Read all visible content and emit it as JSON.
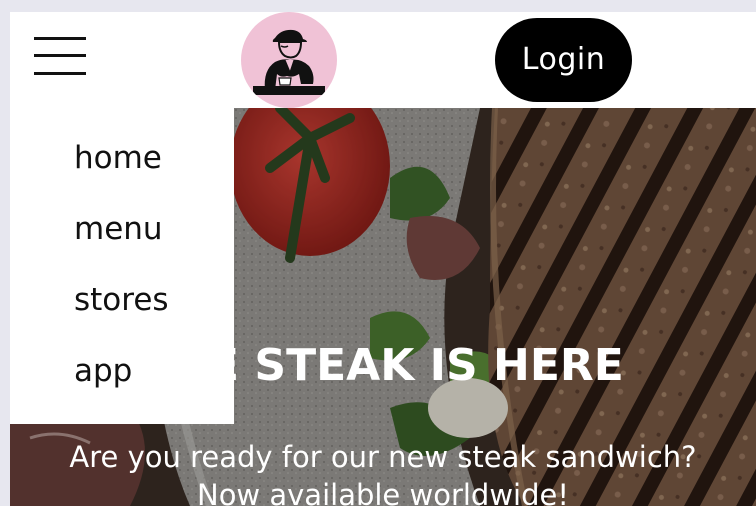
{
  "header": {
    "menu_icon": "hamburger-menu-icon",
    "logo_icon": "man-drinking-coffee-logo",
    "login_label": "Login"
  },
  "nav": {
    "items": [
      {
        "label": "home"
      },
      {
        "label": "menu"
      },
      {
        "label": "stores"
      },
      {
        "label": "app"
      }
    ]
  },
  "hero": {
    "title": "THE STEAK IS HERE",
    "subtitle_line1": "Are you ready for our new steak sandwich?",
    "subtitle_line2": "Now available worldwide!"
  },
  "colors": {
    "logo_bg": "#f0c2d6",
    "login_bg": "#000000",
    "header_bg": "#ffffff",
    "hero_text": "#ffffff"
  }
}
